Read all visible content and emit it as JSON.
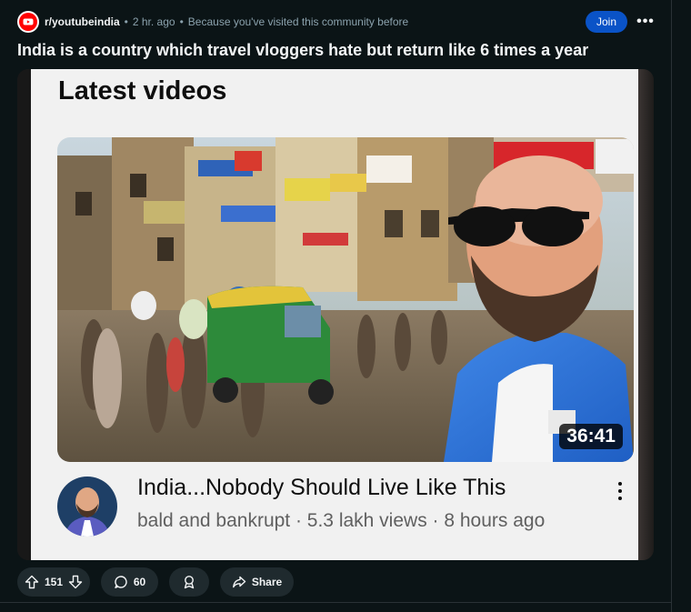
{
  "post": {
    "subreddit": "r/youtubeindia",
    "time": "2 hr. ago",
    "reason": "Because you've visited this community before",
    "join_label": "Join",
    "more_label": "•••",
    "title": "India is a country which travel vloggers hate but return like 6 times a year"
  },
  "media": {
    "heading": "Latest videos",
    "duration": "36:41",
    "video_title": "India...Nobody Should Live Like This",
    "video_meta": "bald and bankrupt · 5.3 lakh views · 8 hours ago"
  },
  "actions": {
    "upvotes": "151",
    "comments": "60",
    "share_label": "Share"
  },
  "icons": {
    "subreddit_icon": "youtube-play-icon",
    "upvote": "arrow-up-icon",
    "downvote": "arrow-down-icon",
    "comment": "speech-bubble-icon",
    "award": "award-icon",
    "share": "share-arrow-icon"
  },
  "colors": {
    "background": "#0b1416",
    "join_button": "#0a53c7",
    "pill": "#1f2a2e",
    "youtube_red": "#ff0000"
  }
}
